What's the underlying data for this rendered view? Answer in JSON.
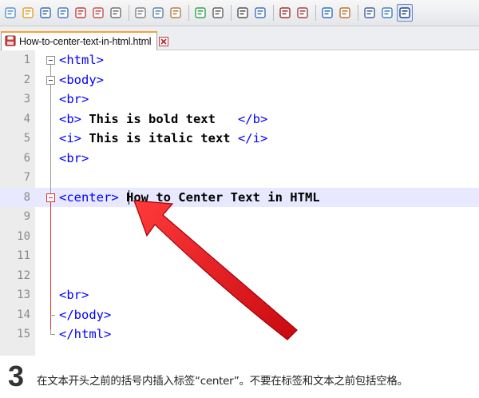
{
  "toolbar": {
    "icons": [
      "new-file-icon",
      "open-file-icon",
      "save-icon",
      "save-all-icon",
      "close-icon",
      "close-all-icon",
      "print-icon",
      "cut-icon",
      "copy-icon",
      "paste-icon",
      "undo-icon",
      "redo-icon",
      "find-icon",
      "replace-icon",
      "zoom-in-icon",
      "zoom-out-icon",
      "sync-vertical-icon",
      "sync-horizontal-icon",
      "word-wrap-icon",
      "show-all-characters-icon",
      "indent-guide-icon"
    ]
  },
  "tab": {
    "label": "How-to-center-text-in-html.html"
  },
  "editor": {
    "lines": [
      {
        "n": "1",
        "tag1": "<html>",
        "text": "",
        "tag2": ""
      },
      {
        "n": "2",
        "tag1": "<body>",
        "text": "",
        "tag2": ""
      },
      {
        "n": "3",
        "tag1": "<br>",
        "text": "",
        "tag2": ""
      },
      {
        "n": "4",
        "tag1": "<b>",
        "text": " This is bold text   ",
        "tag2": "</b>"
      },
      {
        "n": "5",
        "tag1": "<i>",
        "text": " This is italic text ",
        "tag2": "</i>"
      },
      {
        "n": "6",
        "tag1": "<br>",
        "text": "",
        "tag2": ""
      },
      {
        "n": "7",
        "tag1": "",
        "text": "",
        "tag2": ""
      },
      {
        "n": "8",
        "tag1": "<center>",
        "text": " How to Center Text in HTML",
        "tag2": ""
      },
      {
        "n": "9",
        "tag1": "",
        "text": "",
        "tag2": ""
      },
      {
        "n": "10",
        "tag1": "",
        "text": "",
        "tag2": ""
      },
      {
        "n": "11",
        "tag1": "",
        "text": "",
        "tag2": ""
      },
      {
        "n": "12",
        "tag1": "",
        "text": "",
        "tag2": ""
      },
      {
        "n": "13",
        "tag1": "<br>",
        "text": "",
        "tag2": ""
      },
      {
        "n": "14",
        "tag1": "</body>",
        "text": "",
        "tag2": ""
      },
      {
        "n": "15",
        "tag1": "</html>",
        "text": "",
        "tag2": ""
      }
    ]
  },
  "instruction": {
    "step": "3",
    "text": "在文本开头之前的括号内插入标签“center”。不要在标签和文本之前包括空格。"
  },
  "colors": {
    "tag": "#0000ff",
    "text": "#000000",
    "current_line": "#e8e8ff",
    "arrow": "#e8121a",
    "tab_accent": "#f3a33a"
  }
}
